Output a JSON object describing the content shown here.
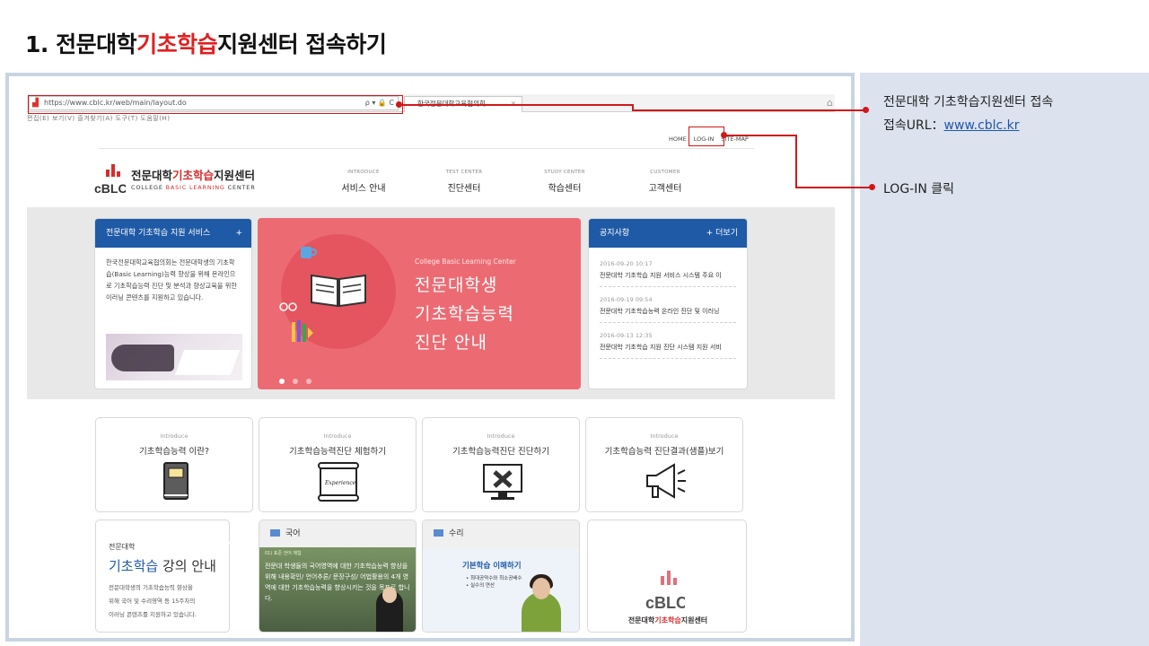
{
  "slide": {
    "title_prefix": "1. 전문대학",
    "title_highlight": "기초학습",
    "title_suffix": "지원센터 접속하기"
  },
  "browser": {
    "url": "https://www.cblc.kr/web/main/layout.do",
    "address_controls": "ρ ▾ 🔒 C",
    "tab_title": "한국전문대학교육협의회 ...",
    "tab_close": "×",
    "menu_bar": "편집(E)  보기(V)  즐겨찾기(A)  도구(T)  도움말(H)"
  },
  "site": {
    "util_links": [
      "HOME",
      "LOG-IN",
      "SITE-MAP"
    ],
    "logo": {
      "kr_prefix": "전문대학",
      "kr_highlight": "기초학습",
      "kr_suffix": "지원센터",
      "en_prefix": "COLLEGE ",
      "en_highlight": "BASIC LEARNING",
      "en_suffix": " CENTER"
    },
    "gnb": [
      {
        "en": "INTRODUCE",
        "ko": "서비스 안내"
      },
      {
        "en": "TEST CENTER",
        "ko": "진단센터"
      },
      {
        "en": "STUDY CENTER",
        "ko": "학습센터"
      },
      {
        "en": "CUSTOMER",
        "ko": "고객센터"
      }
    ],
    "service_card": {
      "title": "전문대학 기초학습 지원 서비스",
      "plus": "+",
      "text": "한국전문대학교육협의회는 전문대학생의 기초학습(Basic Learning)능력 향상을 위해 온라인으로 기초학습능력 진단 및 분석과 향상교육을 위한 이러닝 콘텐츠를 지원하고 있습니다."
    },
    "hero": {
      "sub": "College Basic Learning Center",
      "lines": [
        "전문대학생",
        "기초학습능력",
        "진단 안내"
      ]
    },
    "notice": {
      "title": "공지사항",
      "more": "+ 더보기",
      "items": [
        {
          "date": "2016-09-20 10:17",
          "title": "전문대학 기초학습 지원 서비스 시스템 주요 이"
        },
        {
          "date": "2016-09-19 09:54",
          "title": "전문대학 기초학습능력 온라인 진단 및 이러닝"
        },
        {
          "date": "2016-09-13 12:35",
          "title": "전문대학 기초학습 지원 진단 시스템 지원 서비"
        }
      ]
    },
    "intro_cards": [
      {
        "en": "Introduce",
        "ko": "기초학습능력 이란?",
        "icon": "book-icon"
      },
      {
        "en": "Introduce",
        "ko": "기초학습능력진단 체험하기",
        "icon": "experience-scroll-icon"
      },
      {
        "en": "Introduce",
        "ko": "기초학습능력진단 진단하기",
        "icon": "monitor-icon"
      },
      {
        "en": "Introduce",
        "ko": "기초학습능력 진단결과(샘플)보기",
        "icon": "megaphone-icon"
      }
    ],
    "lecture": {
      "a": "전문대학",
      "b_highlight": "기초학습",
      "b_rest": " 강의 안내",
      "c": [
        "전문대학생의 기초학습능력 향상을",
        "위해 국어 및 수리영역 등 15주차의",
        "이러닝 콘텐츠를 지원하고 있습니다."
      ]
    },
    "korean": {
      "title": "국어",
      "tag": "01) 표준 언어 체험",
      "text": "전문대 학생들의 국어영역에 대한 기초학습능력 향상을 위해 내용확인/ 언어추론/ 문장구성/ 어법활용의 4개 영역에 대한 기초학습능력을 향상시키는 것을 목표로 합니다."
    },
    "math": {
      "title": "수리",
      "video_title": "기본학습 이해하기",
      "bullets": [
        "• 최대공약수와 최소공배수",
        "• 실수의 연산"
      ]
    },
    "big_logo": {
      "prefix": "전문대학",
      "highlight": "기초학습",
      "suffix": "지원센터"
    }
  },
  "annotations": {
    "a1_line1": "전문대학  기초학습지원센터  접속",
    "a1_line2_label": "접속URL：",
    "a1_line2_link": "www.cblc.kr",
    "a2": "LOG-IN  클릭"
  },
  "colors": {
    "accent_red": "#d01818",
    "brand_blue": "#1f5aa6",
    "hero_pink": "#ec6b73",
    "side_panel": "#dce3ef"
  }
}
